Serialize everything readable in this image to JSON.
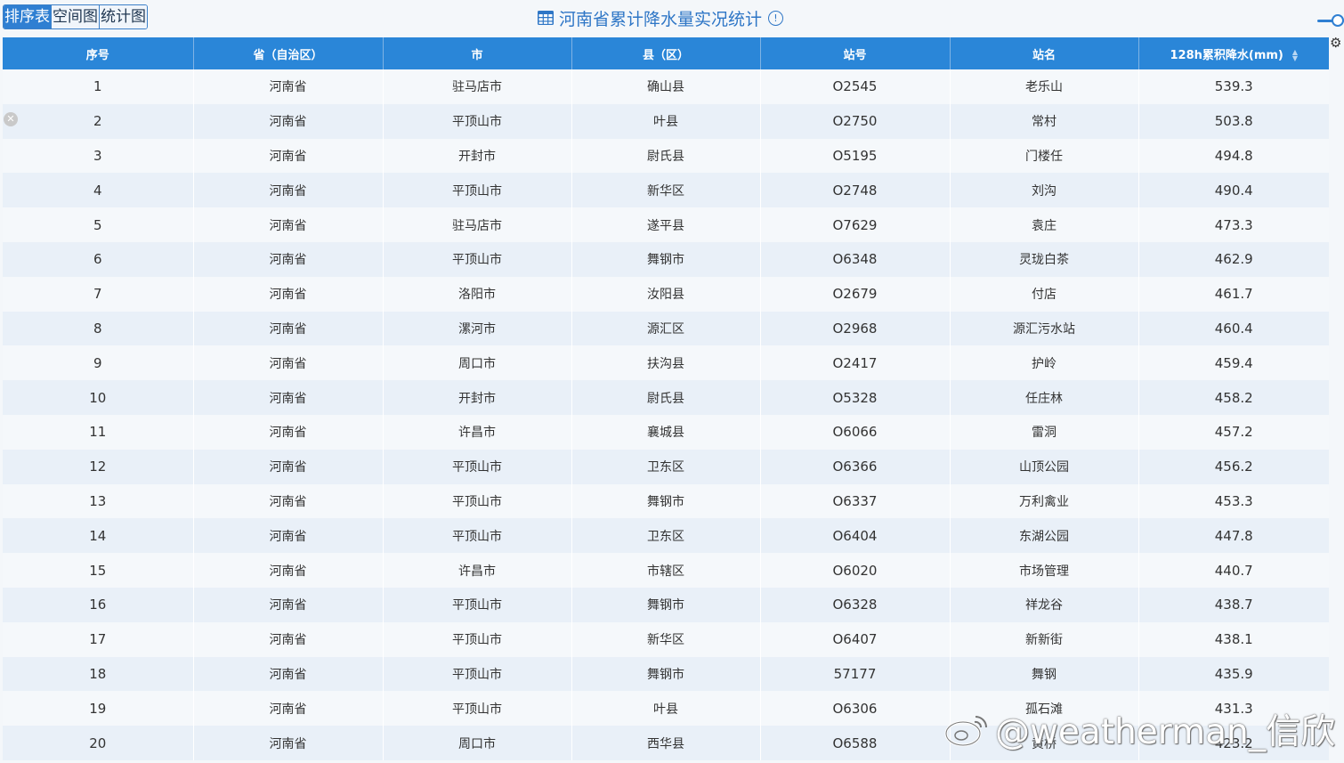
{
  "tabs": [
    {
      "label": "排序表",
      "active": true
    },
    {
      "label": "空间图",
      "active": false
    },
    {
      "label": "统计图",
      "active": false
    }
  ],
  "title": "河南省累计降水量实况统计",
  "table": {
    "headers": [
      "序号",
      "省（自治区）",
      "市",
      "县（区）",
      "站号",
      "站名",
      "128h累积降水(mm)"
    ],
    "rows": [
      [
        "1",
        "河南省",
        "驻马店市",
        "确山县",
        "O2545",
        "老乐山",
        "539.3"
      ],
      [
        "2",
        "河南省",
        "平顶山市",
        "叶县",
        "O2750",
        "常村",
        "503.8"
      ],
      [
        "3",
        "河南省",
        "开封市",
        "尉氏县",
        "O5195",
        "门楼任",
        "494.8"
      ],
      [
        "4",
        "河南省",
        "平顶山市",
        "新华区",
        "O2748",
        "刘沟",
        "490.4"
      ],
      [
        "5",
        "河南省",
        "驻马店市",
        "遂平县",
        "O7629",
        "袁庄",
        "473.3"
      ],
      [
        "6",
        "河南省",
        "平顶山市",
        "舞钢市",
        "O6348",
        "灵珑白茶",
        "462.9"
      ],
      [
        "7",
        "河南省",
        "洛阳市",
        "汝阳县",
        "O2679",
        "付店",
        "461.7"
      ],
      [
        "8",
        "河南省",
        "漯河市",
        "源汇区",
        "O2968",
        "源汇污水站",
        "460.4"
      ],
      [
        "9",
        "河南省",
        "周口市",
        "扶沟县",
        "O2417",
        "护岭",
        "459.4"
      ],
      [
        "10",
        "河南省",
        "开封市",
        "尉氏县",
        "O5328",
        "任庄林",
        "458.2"
      ],
      [
        "11",
        "河南省",
        "许昌市",
        "襄城县",
        "O6066",
        "雷洞",
        "457.2"
      ],
      [
        "12",
        "河南省",
        "平顶山市",
        "卫东区",
        "O6366",
        "山顶公园",
        "456.2"
      ],
      [
        "13",
        "河南省",
        "平顶山市",
        "舞钢市",
        "O6337",
        "万利禽业",
        "453.3"
      ],
      [
        "14",
        "河南省",
        "平顶山市",
        "卫东区",
        "O6404",
        "东湖公园",
        "447.8"
      ],
      [
        "15",
        "河南省",
        "许昌市",
        "市辖区",
        "O6020",
        "市场管理",
        "440.7"
      ],
      [
        "16",
        "河南省",
        "平顶山市",
        "舞钢市",
        "O6328",
        "祥龙谷",
        "438.7"
      ],
      [
        "17",
        "河南省",
        "平顶山市",
        "新华区",
        "O6407",
        "新新街",
        "438.1"
      ],
      [
        "18",
        "河南省",
        "平顶山市",
        "舞钢市",
        "57177",
        "舞钢",
        "435.9"
      ],
      [
        "19",
        "河南省",
        "平顶山市",
        "叶县",
        "O6306",
        "孤石滩",
        "431.3"
      ],
      [
        "20",
        "河南省",
        "周口市",
        "西华县",
        "O6588",
        "黄桥",
        "423.2"
      ]
    ]
  },
  "watermark": {
    "text": "@weatherman_信欣"
  },
  "colors": {
    "header_bg": "#2a86d8",
    "accent": "#2e76c6",
    "row_odd": "#f5f8fb",
    "row_even": "#e9f0f8"
  }
}
